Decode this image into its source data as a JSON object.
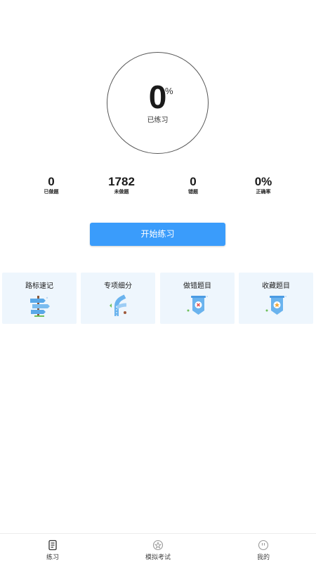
{
  "progress": {
    "value": "0",
    "unit": "%",
    "label": "已练习"
  },
  "stats": [
    {
      "value": "0",
      "label": "已做题"
    },
    {
      "value": "1782",
      "label": "未做题"
    },
    {
      "value": "0",
      "label": "错题"
    },
    {
      "value": "0%",
      "label": "正确率"
    }
  ],
  "start_button": "开始练习",
  "cards": [
    {
      "title": "路标速记",
      "icon": "signpost-icon"
    },
    {
      "title": "专项细分",
      "icon": "road-junction-icon"
    },
    {
      "title": "做错题目",
      "icon": "wrong-badge-icon"
    },
    {
      "title": "收藏题目",
      "icon": "favorite-badge-icon"
    }
  ],
  "tabbar": [
    {
      "label": "练习",
      "icon": "document-icon",
      "active": true
    },
    {
      "label": "模拟考试",
      "icon": "exam-icon",
      "active": false
    },
    {
      "label": "我的",
      "icon": "profile-icon",
      "active": false
    }
  ],
  "colors": {
    "accent": "#3a9cfb",
    "card_bg": "#eef6fd"
  }
}
